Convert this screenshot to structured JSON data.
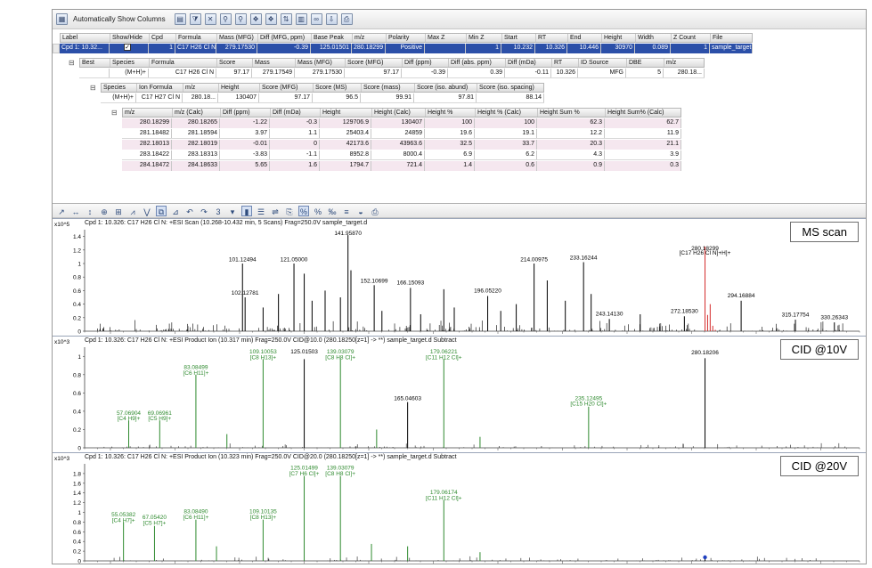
{
  "toolbar": {
    "auto_columns_label": "Automatically Show Columns"
  },
  "grid": {
    "header1": [
      "Label",
      "Show/Hide",
      "Cpd",
      "Formula",
      "Mass (MFG)",
      "Diff (MFG, ppm)",
      "Base Peak",
      "m/z",
      "Polarity",
      "Max Z",
      "Min Z",
      "Start",
      "RT",
      "End",
      "Height",
      "Width",
      "Z Count",
      "File"
    ],
    "row1": [
      "Cpd 1: 10.32...",
      "",
      "1",
      "C17 H26 Cl N",
      "279.17530",
      "-0.39",
      "125.01501",
      "280.18299",
      "Positive",
      "",
      "1",
      "10.232",
      "10.326",
      "10.446",
      "30970",
      "0.089",
      "1",
      "sample_target.d"
    ],
    "header2": [
      "Best",
      "Species",
      "Formula",
      "Score",
      "Mass",
      "Mass (MFG)",
      "Score (MFG)",
      "Diff (ppm)",
      "Diff (abs. ppm)",
      "Diff (mDa)",
      "RT",
      "ID Source",
      "DBE",
      "m/z"
    ],
    "row2": [
      "",
      "(M+H)+",
      "C17 H26 Cl N",
      "97.17",
      "279.17549",
      "279.17530",
      "97.17",
      "-0.39",
      "0.39",
      "-0.11",
      "10.326",
      "MFG",
      "5",
      "280.18..."
    ],
    "header3": [
      "Species",
      "Ion Formula",
      "m/z",
      "Height",
      "Score (MFG)",
      "Score (MS)",
      "Score (mass)",
      "Score (iso. abund)",
      "Score (iso. spacing)"
    ],
    "row3": [
      "(M+H)+",
      "C17 H27 Cl N",
      "280.18...",
      "130407",
      "97.17",
      "96.5",
      "99.91",
      "97.81",
      "88.14"
    ],
    "header4": [
      "m/z",
      "m/z (Calc)",
      "Diff (ppm)",
      "Diff (mDa)",
      "Height",
      "Height (Calc)",
      "Height %",
      "Height % (Calc)",
      "Height Sum %",
      "Height Sum% (Calc)"
    ],
    "rows4": [
      [
        "280.18299",
        "280.18265",
        "-1.22",
        "-0.3",
        "129706.9",
        "130407",
        "100",
        "100",
        "62.3",
        "62.7"
      ],
      [
        "281.18482",
        "281.18594",
        "3.97",
        "1.1",
        "25403.4",
        "24859",
        "19.6",
        "19.1",
        "12.2",
        "11.9"
      ],
      [
        "282.18013",
        "282.18019",
        "-0.01",
        "0",
        "42173.6",
        "43963.6",
        "32.5",
        "33.7",
        "20.3",
        "21.1"
      ],
      [
        "283.18422",
        "283.18313",
        "-3.83",
        "-1.1",
        "8952.8",
        "8000.4",
        "6.9",
        "6.2",
        "4.3",
        "3.9"
      ],
      [
        "284.18472",
        "284.18633",
        "5.65",
        "1.6",
        "1794.7",
        "721.4",
        "1.4",
        "0.6",
        "0.9",
        "0.3"
      ]
    ]
  },
  "chart_toolbar": {
    "count_value": "3"
  },
  "panels": [
    {
      "title": "Cpd 1: 10.326: C17 H26 Cl N: +ESI Scan (10.268-10.432 min, 5 Scans) Frag=250.0V sample_target.d",
      "tag": "MS scan",
      "scale": "x10^5",
      "yticks": [
        "1.4",
        "1.2",
        "1",
        "0.8",
        "0.6",
        "0.4",
        "0.2",
        "0"
      ],
      "labels": [
        {
          "text": "141.95870",
          "x": 141.96,
          "y": 1.42,
          "color": "#000"
        },
        {
          "text": "121.05000",
          "x": 121.05,
          "y": 1.03,
          "color": "#000"
        },
        {
          "text": "101.12494",
          "x": 101.12,
          "y": 1.03,
          "color": "#000"
        },
        {
          "text": "214.00975",
          "x": 214.01,
          "y": 1.03,
          "color": "#000"
        },
        {
          "text": "233.16244",
          "x": 233.16,
          "y": 1.06,
          "color": "#000"
        },
        {
          "text": "152.10699",
          "x": 152.11,
          "y": 0.72,
          "color": "#000"
        },
        {
          "text": "166.15093",
          "x": 166.15,
          "y": 0.69,
          "color": "#000"
        },
        {
          "text": "196.05220",
          "x": 196.05,
          "y": 0.57,
          "color": "#000"
        },
        {
          "text": "102.12781",
          "x": 102.13,
          "y": 0.54,
          "color": "#000"
        },
        {
          "text": "280.18299",
          "x": 280.18,
          "y": 1.2,
          "color": "#000"
        },
        {
          "text": "[C17 H26 Cl N]+H]+",
          "x": 280.18,
          "y": 1.13,
          "color": "#000"
        },
        {
          "text": "243.14130",
          "x": 243.14,
          "y": 0.23,
          "color": "#000"
        },
        {
          "text": "272.18530",
          "x": 272.19,
          "y": 0.27,
          "color": "#000"
        },
        {
          "text": "294.16884",
          "x": 294.17,
          "y": 0.5,
          "color": "#000"
        },
        {
          "text": "315.17754",
          "x": 315.18,
          "y": 0.22,
          "color": "#000"
        },
        {
          "text": "330.26343",
          "x": 330.26,
          "y": 0.18,
          "color": "#000"
        }
      ]
    },
    {
      "title": "Cpd 1: 10.326: C17 H26 Cl N: +ESI Product Ion (10.317 min) Frag=250.0V CID@10.0 (280.18250[z=1] -> **) sample_target.d  Subtract",
      "tag": "CID @10V",
      "scale": "x10^3",
      "yticks": [
        "1",
        "0.8",
        "0.6",
        "0.4",
        "0.2",
        "0"
      ],
      "labels": [
        {
          "text": "109.10053",
          "x": 109.1,
          "y": 1.03,
          "color": "#2e8a2e"
        },
        {
          "text": "[C8 H13]+",
          "x": 109.1,
          "y": 0.97,
          "color": "#2e8a2e"
        },
        {
          "text": "125.01503",
          "x": 125.02,
          "y": 1.03,
          "color": "#000"
        },
        {
          "text": "139.03079",
          "x": 139.03,
          "y": 1.03,
          "color": "#2e8a2e"
        },
        {
          "text": "[C8 H8 Cl]+",
          "x": 139.03,
          "y": 0.97,
          "color": "#2e8a2e"
        },
        {
          "text": "179.06221",
          "x": 179.06,
          "y": 1.03,
          "color": "#2e8a2e"
        },
        {
          "text": "[C11 H12 Cl]+",
          "x": 179.06,
          "y": 0.97,
          "color": "#2e8a2e"
        },
        {
          "text": "83.08499",
          "x": 83.08,
          "y": 0.86,
          "color": "#2e8a2e"
        },
        {
          "text": "[C6 H11]+",
          "x": 83.08,
          "y": 0.8,
          "color": "#2e8a2e"
        },
        {
          "text": "57.06904",
          "x": 57.07,
          "y": 0.36,
          "color": "#2e8a2e"
        },
        {
          "text": "[C4 H9]+",
          "x": 57.07,
          "y": 0.3,
          "color": "#2e8a2e"
        },
        {
          "text": "69.06961",
          "x": 69.07,
          "y": 0.36,
          "color": "#2e8a2e"
        },
        {
          "text": "[C5 H9]+",
          "x": 69.07,
          "y": 0.3,
          "color": "#2e8a2e"
        },
        {
          "text": "165.04603",
          "x": 165.05,
          "y": 0.52,
          "color": "#000"
        },
        {
          "text": "235.12495",
          "x": 235.12,
          "y": 0.52,
          "color": "#2e8a2e"
        },
        {
          "text": "[C15 H20 Cl]+",
          "x": 235.12,
          "y": 0.46,
          "color": "#2e8a2e"
        },
        {
          "text": "280.18206",
          "x": 280.18,
          "y": 1.02,
          "color": "#000"
        }
      ]
    },
    {
      "title": "Cpd 1: 10.326: C17 H26 Cl N: +ESI Product Ion (10.323 min) Frag=250.0V CID@20.0 (280.18250[z=1] -> **) sample_target.d  Subtract",
      "tag": "CID @20V",
      "scale": "x10^3",
      "yticks": [
        "1.8",
        "1.6",
        "1.4",
        "1.2",
        "1",
        "0.8",
        "0.6",
        "0.4",
        "0.2",
        "0"
      ],
      "labels": [
        {
          "text": "125.01499",
          "x": 125.01,
          "y": 1.88,
          "color": "#2e8a2e"
        },
        {
          "text": "[C7 H6 Cl]+",
          "x": 125.01,
          "y": 1.76,
          "color": "#2e8a2e"
        },
        {
          "text": "139.03079",
          "x": 139.03,
          "y": 1.88,
          "color": "#2e8a2e"
        },
        {
          "text": "[C8 H8 Cl]+",
          "x": 139.03,
          "y": 1.76,
          "color": "#2e8a2e"
        },
        {
          "text": "179.06174",
          "x": 179.06,
          "y": 1.38,
          "color": "#2e8a2e"
        },
        {
          "text": "[C11 H12 Cl]+",
          "x": 179.06,
          "y": 1.26,
          "color": "#2e8a2e"
        },
        {
          "text": "55.05382",
          "x": 55.05,
          "y": 0.92,
          "color": "#2e8a2e"
        },
        {
          "text": "[C4 H7]+",
          "x": 55.05,
          "y": 0.8,
          "color": "#2e8a2e"
        },
        {
          "text": "67.05420",
          "x": 67.05,
          "y": 0.86,
          "color": "#2e8a2e"
        },
        {
          "text": "[C5 H7]+",
          "x": 67.05,
          "y": 0.74,
          "color": "#2e8a2e"
        },
        {
          "text": "83.08490",
          "x": 83.08,
          "y": 0.98,
          "color": "#2e8a2e"
        },
        {
          "text": "[C6 H11]+",
          "x": 83.08,
          "y": 0.86,
          "color": "#2e8a2e"
        },
        {
          "text": "109.10135",
          "x": 109.1,
          "y": 0.98,
          "color": "#2e8a2e"
        },
        {
          "text": "[C8 H13]+",
          "x": 109.1,
          "y": 0.86,
          "color": "#2e8a2e"
        }
      ]
    }
  ],
  "chart_data": [
    {
      "type": "bar",
      "title": "Cpd 1: 10.326: C17 H26 Cl N: +ESI Scan (10.268-10.432 min, 5 Scans) Frag=250.0V sample_target.d",
      "xlim": [
        40,
        340
      ],
      "ylim": [
        0,
        1.5
      ],
      "ylabel": "x10^5",
      "series": [
        {
          "color": "#000000",
          "x": [
            101.12,
            102.13,
            109.1,
            115.05,
            121.05,
            125.02,
            128.06,
            133.1,
            139.03,
            141.96,
            143.1,
            152.11,
            155.1,
            166.15,
            170.1,
            179.06,
            183.1,
            196.05,
            201.1,
            207.1,
            214.01,
            219.1,
            226.1,
            233.16,
            236.1,
            243.14,
            255.1,
            272.19,
            294.17,
            315.18,
            330.26
          ],
          "y": [
            1.0,
            0.5,
            0.35,
            0.55,
            1.0,
            0.85,
            0.45,
            0.6,
            0.5,
            1.42,
            0.9,
            0.68,
            0.3,
            0.64,
            0.25,
            0.62,
            0.35,
            0.52,
            0.3,
            0.4,
            1.0,
            0.75,
            0.45,
            1.02,
            0.55,
            0.18,
            0.25,
            0.22,
            0.45,
            0.17,
            0.13
          ]
        },
        {
          "color": "#d42b2b",
          "x": [
            280.18,
            281.18,
            282.18,
            283.18,
            284.18
          ],
          "y": [
            1.25,
            0.24,
            0.4,
            0.08,
            0.02
          ]
        }
      ]
    },
    {
      "type": "bar",
      "title": "Cpd 1: 10.326: C17 H26 Cl N: +ESI Product Ion (10.317 min) Frag=250.0V CID@10.0 (280.18250[z=1] -> **) sample_target.d  Subtract",
      "xlim": [
        40,
        340
      ],
      "ylim": [
        0,
        1.1
      ],
      "ylabel": "x10^3",
      "series": [
        {
          "color": "#2e8a2e",
          "x": [
            57.07,
            69.07,
            83.08,
            95.08,
            109.1,
            139.03,
            153.05,
            179.06,
            193.08,
            235.12
          ],
          "y": [
            0.3,
            0.3,
            0.8,
            0.15,
            0.97,
            0.97,
            0.2,
            0.97,
            0.12,
            0.45
          ]
        },
        {
          "color": "#000000",
          "x": [
            125.02,
            165.05,
            280.18
          ],
          "y": [
            0.97,
            0.5,
            0.98
          ]
        }
      ]
    },
    {
      "type": "bar",
      "title": "Cpd 1: 10.326: C17 H26 Cl N: +ESI Product Ion (10.323 min) Frag=250.0V CID@20.0 (280.18250[z=1] -> **) sample_target.d  Subtract",
      "xlim": [
        40,
        340
      ],
      "ylim": [
        0,
        2.0
      ],
      "ylabel": "x10^3",
      "series": [
        {
          "color": "#2e8a2e",
          "x": [
            55.05,
            67.05,
            83.08,
            91.05,
            109.1,
            125.01,
            139.03,
            151.05,
            165.05,
            179.06,
            193.08
          ],
          "y": [
            0.8,
            0.72,
            0.85,
            0.3,
            0.85,
            1.75,
            1.75,
            0.35,
            0.3,
            1.25,
            0.18
          ]
        },
        {
          "color": "#000000",
          "x": [
            280.18
          ],
          "y": [
            0.05
          ]
        }
      ]
    }
  ]
}
